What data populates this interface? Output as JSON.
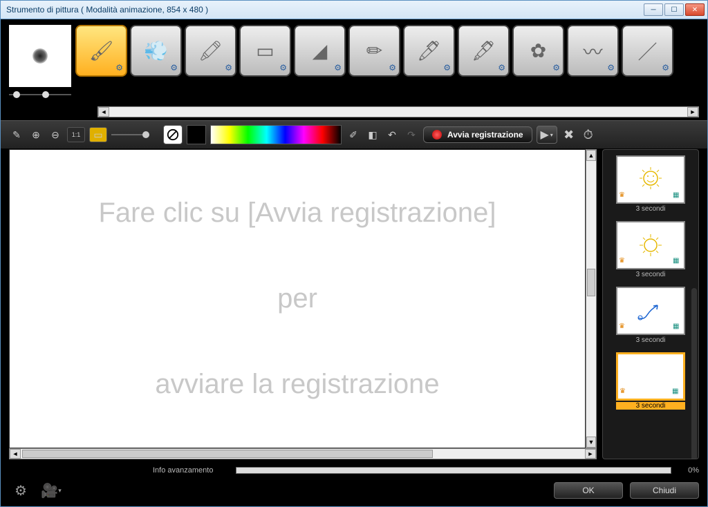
{
  "window": {
    "title": "Strumento di pittura ( Modalità animazione, 854 x 480 )",
    "minimize": "minimize",
    "maximize": "maximize",
    "close": "close"
  },
  "brushes": [
    {
      "name": "paintbrush",
      "selected": true
    },
    {
      "name": "airbrush",
      "selected": false
    },
    {
      "name": "crayon",
      "selected": false
    },
    {
      "name": "eraser-soft",
      "selected": false
    },
    {
      "name": "chisel",
      "selected": false
    },
    {
      "name": "pencil",
      "selected": false
    },
    {
      "name": "marker",
      "selected": false
    },
    {
      "name": "thick-marker",
      "selected": false
    },
    {
      "name": "splatter",
      "selected": false
    },
    {
      "name": "ink-brush",
      "selected": false
    },
    {
      "name": "calligraphy",
      "selected": false
    }
  ],
  "toolbar": {
    "record_label": "Avvia registrazione"
  },
  "canvas": {
    "line1": "Fare clic su  [Avvia registrazione]",
    "line2": "per",
    "line3": "avviare la registrazione"
  },
  "frames": [
    {
      "caption": "3 secondi",
      "kind": "sun-smile",
      "selected": false
    },
    {
      "caption": "3 secondi",
      "kind": "sun",
      "selected": false
    },
    {
      "caption": "3 secondi",
      "kind": "arrow",
      "selected": false
    },
    {
      "caption": "3 secondi",
      "kind": "blank",
      "selected": true
    }
  ],
  "progress": {
    "label": "Info avanzamento",
    "percent": "0%"
  },
  "buttons": {
    "ok": "OK",
    "close": "Chiudi"
  }
}
